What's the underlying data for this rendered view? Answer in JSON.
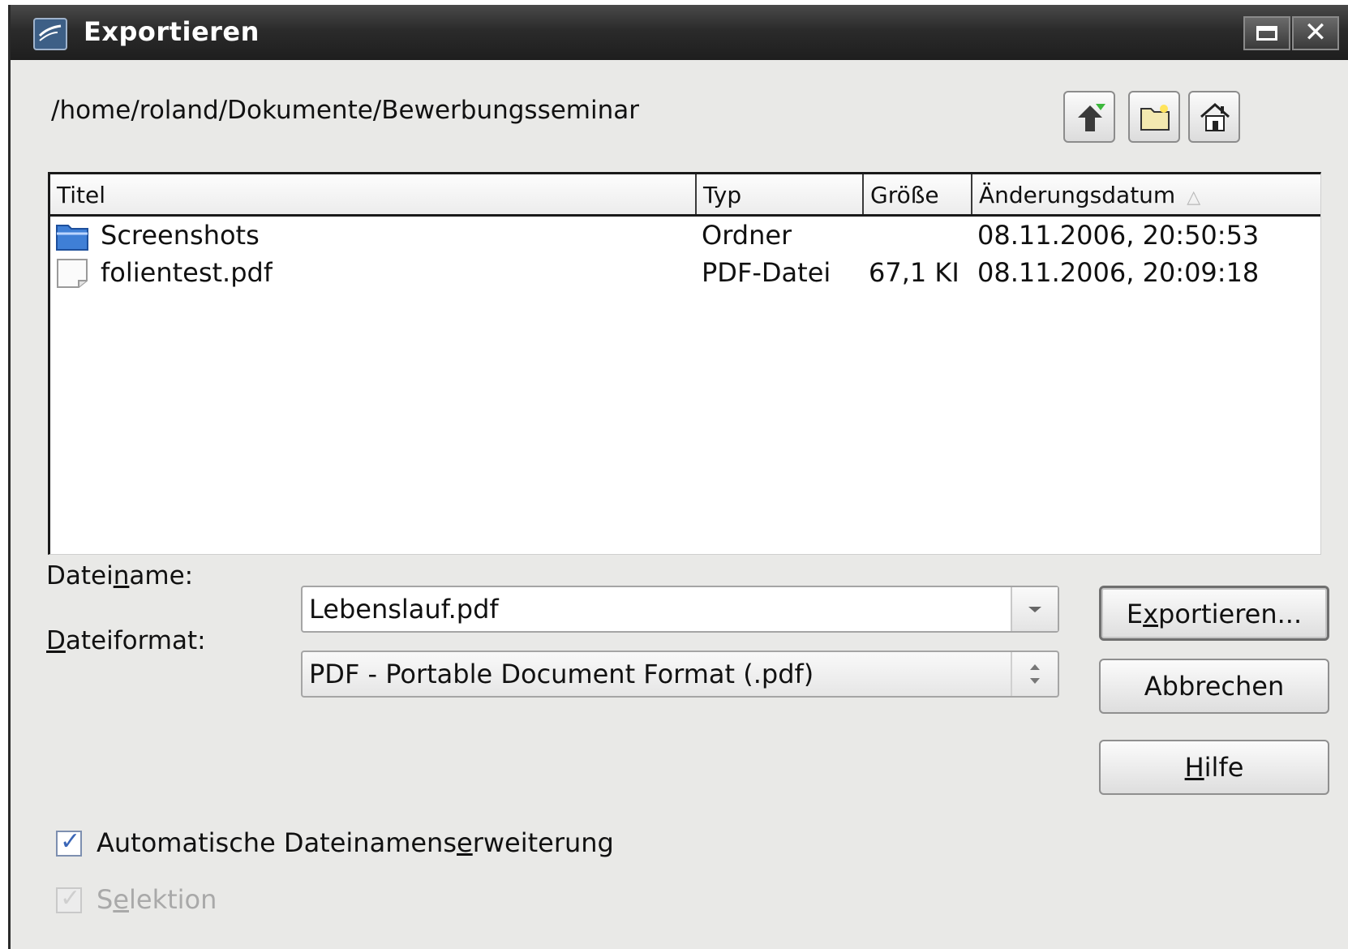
{
  "window": {
    "title": "Exportieren"
  },
  "path": "/home/roland/Dokumente/Bewerbungsseminar",
  "toolbar": {
    "icons": [
      "up-folder-icon",
      "new-folder-icon",
      "home-icon"
    ]
  },
  "file_list": {
    "columns": {
      "title": "Titel",
      "type": "Typ",
      "size": "Größe",
      "date": "Änderungsdatum",
      "sort_indicator": "△"
    },
    "rows": [
      {
        "icon": "folder-icon",
        "name": "Screenshots",
        "type": "Ordner",
        "size": "",
        "date": "08.11.2006, 20:50:53"
      },
      {
        "icon": "document-icon",
        "name": "folientest.pdf",
        "type": "PDF-Datei",
        "size": "67,1 KI",
        "date": "08.11.2006, 20:09:18"
      }
    ]
  },
  "form": {
    "filename_label_pre": "Datei",
    "filename_label_u": "n",
    "filename_label_post": "ame:",
    "filename_value": "Lebenslauf.pdf",
    "format_label_u": "D",
    "format_label_post": "ateiformat:",
    "format_value": "PDF - Portable Document Format (.pdf)"
  },
  "buttons": {
    "export_pre": "E",
    "export_u": "x",
    "export_post": "portieren...",
    "cancel": "Abbrechen",
    "help_u": "H",
    "help_post": "ilfe"
  },
  "options": {
    "auto_ext_pre": "Automatische Dateinamens",
    "auto_ext_u": "e",
    "auto_ext_post": "rweiterung",
    "auto_ext_checked": true,
    "selection_pre": "S",
    "selection_u": "e",
    "selection_post": "lektion",
    "selection_checked": true,
    "selection_enabled": false
  },
  "colors": {
    "titlebar": "#2b2b2b",
    "dialog_bg": "#e9e9e7",
    "folder_blue": "#3f7fd6",
    "checkmark": "#3a66b7"
  }
}
